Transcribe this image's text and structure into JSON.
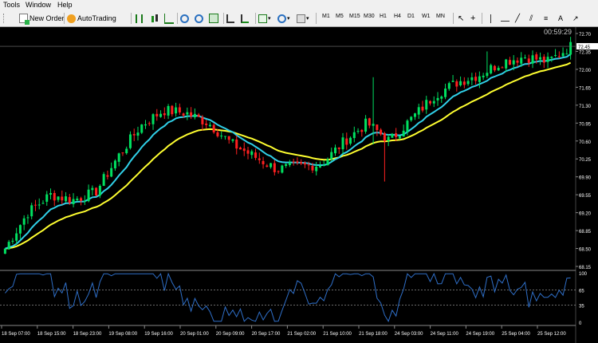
{
  "menu": {
    "items": [
      "Tools",
      "Window",
      "Help"
    ]
  },
  "toolbar": {
    "new_order_label": "New Order",
    "autotrading_label": "AutoTrading",
    "timeframes": [
      "M1",
      "M5",
      "M15",
      "M30",
      "H1",
      "H4",
      "D1",
      "W1",
      "MN"
    ]
  },
  "chart": {
    "countdown": "00:59:29",
    "current_price": "72.45",
    "price_axis_labels": [
      "72.70",
      "72.35",
      "72.00",
      "71.65",
      "71.30",
      "70.95",
      "70.60",
      "70.25",
      "69.90",
      "69.55",
      "69.20",
      "68.85",
      "68.50",
      "68.15"
    ],
    "indicator_axis_labels": [
      "100",
      "65",
      "35",
      "0"
    ],
    "time_axis_labels": [
      "18 Sep 07:00",
      "18 Sep 15:00",
      "18 Sep 23:00",
      "19 Sep 08:00",
      "19 Sep 16:00",
      "20 Sep 01:00",
      "20 Sep 09:00",
      "20 Sep 17:00",
      "21 Sep 02:00",
      "21 Sep 10:00",
      "21 Sep 18:00",
      "24 Sep 03:00",
      "24 Sep 11:00",
      "24 Sep 19:00",
      "25 Sep 04:00",
      "25 Sep 12:00"
    ],
    "colors": {
      "bull": "#00e060",
      "bear": "#ff2020",
      "ma_fast": "#30d0e8",
      "ma_slow": "#ffff30",
      "oscillator": "#2f6fc8",
      "axis_text": "#ffffff"
    },
    "price_levels": [
      68.5,
      69.2,
      69.55,
      69.45,
      69.6,
      70.3,
      70.9,
      71.2,
      71.15,
      70.95,
      70.55,
      70.3,
      70.05,
      70.1,
      70.15,
      70.6,
      70.95,
      70.6,
      71.05,
      71.5,
      71.75,
      71.9,
      72.15,
      72.25,
      72.15,
      72.45
    ]
  }
}
